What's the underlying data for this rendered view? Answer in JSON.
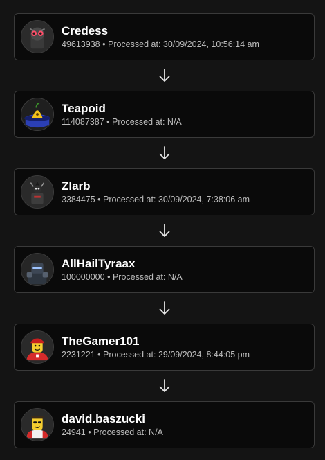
{
  "separator": "•",
  "processed_prefix": "Processed at:",
  "users": [
    {
      "name": "Credess",
      "id": "49613938",
      "processed_at": "30/09/2024, 10:56:14 am",
      "avatar_icon": "credess-avatar-icon"
    },
    {
      "name": "Teapoid",
      "id": "114087387",
      "processed_at": "N/A",
      "avatar_icon": "teapoid-avatar-icon"
    },
    {
      "name": "Zlarb",
      "id": "3384475",
      "processed_at": "30/09/2024, 7:38:06 am",
      "avatar_icon": "zlarb-avatar-icon"
    },
    {
      "name": "AllHailTyraax",
      "id": "100000000",
      "processed_at": "N/A",
      "avatar_icon": "allhailtyraax-avatar-icon"
    },
    {
      "name": "TheGamer101",
      "id": "2231221",
      "processed_at": "29/09/2024, 8:44:05 pm",
      "avatar_icon": "thegamer101-avatar-icon"
    },
    {
      "name": "david.baszucki",
      "id": "24941",
      "processed_at": "N/A",
      "avatar_icon": "david-baszucki-avatar-icon"
    }
  ],
  "arrow_icon": "arrow-down-icon",
  "colors": {
    "background": "#141414",
    "card_background": "#0a0a0a",
    "card_border": "#3a3a3a",
    "name_text": "#ffffff",
    "meta_text": "#bdbdbd",
    "arrow": "#e6e6e6"
  }
}
